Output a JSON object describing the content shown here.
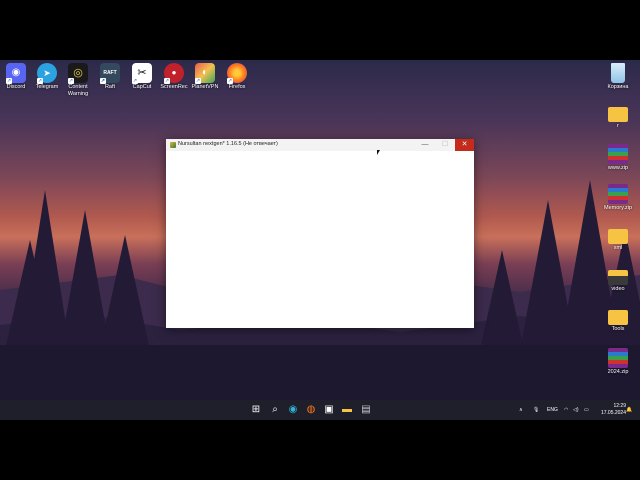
{
  "desktop_icons_top": [
    {
      "name": "discord-icon",
      "label": "Discord",
      "color": "#5865f2",
      "glyph": "◉"
    },
    {
      "name": "telegram-icon",
      "label": "Telegram",
      "color": "#2aa3e0",
      "glyph": "➤"
    },
    {
      "name": "content-warning-icon",
      "label": "Content Warning",
      "color": "#1a1a1a",
      "glyph": "◎"
    },
    {
      "name": "raft-icon",
      "label": "Raft",
      "color": "#34495e",
      "glyph": "RAFT"
    },
    {
      "name": "capcut-icon",
      "label": "CapCut",
      "color": "#ffffff",
      "glyph": "✂"
    },
    {
      "name": "screenrec-icon",
      "label": "ScreenRec",
      "color": "#c0212a",
      "glyph": "●"
    },
    {
      "name": "planetvpn-icon",
      "label": "PlanetVPN",
      "color": "#e85a4f",
      "glyph": "◐"
    },
    {
      "name": "firefox-icon",
      "label": "Firefox",
      "color": "#ff7a1a",
      "glyph": "◍"
    }
  ],
  "desktop_icons_right": [
    {
      "name": "recycle-bin-icon",
      "label": "Корзина",
      "type": "bin"
    },
    {
      "name": "folder-icon",
      "label": "г",
      "type": "folder"
    },
    {
      "name": "winrar-archive-icon",
      "label": "www.zip",
      "type": "rar"
    },
    {
      "name": "winrar-archive-icon",
      "label": "Memory.zip",
      "type": "rar"
    },
    {
      "name": "folder-icon",
      "label": "xml",
      "type": "folder"
    },
    {
      "name": "folder-icon",
      "label": "video",
      "type": "folder"
    },
    {
      "name": "folder-icon",
      "label": "Tools",
      "type": "folder"
    },
    {
      "name": "winrar-archive-icon",
      "label": "2024.zip",
      "type": "rar"
    }
  ],
  "window": {
    "title": "Nursultan nextgen* 1.16.5 (Не отвечает)",
    "minimize": "—",
    "maximize": "☐",
    "close": "✕"
  },
  "taskbar": {
    "icons": [
      {
        "name": "start-icon",
        "glyph": "⊞",
        "color": "#4cc2ff"
      },
      {
        "name": "search-icon",
        "glyph": "⌕",
        "color": "#ffffff"
      },
      {
        "name": "edge-icon",
        "glyph": "◉",
        "color": "#2fb4d8"
      },
      {
        "name": "firefox-icon",
        "glyph": "◍",
        "color": "#ff7a1a"
      },
      {
        "name": "task-view-icon",
        "glyph": "▣",
        "color": "#ffffff"
      },
      {
        "name": "file-explorer-icon",
        "glyph": "▬",
        "color": "#f6c343"
      },
      {
        "name": "app-icon",
        "glyph": "▤",
        "color": "#cccccc"
      }
    ],
    "tray": {
      "chevron": "∧",
      "mic": "🎙",
      "lang": "ENG",
      "wifi": "◠",
      "speaker": "◁)",
      "battery": "▭",
      "bell": "🔔"
    },
    "time": "12:29",
    "date": "17.05.2024"
  }
}
